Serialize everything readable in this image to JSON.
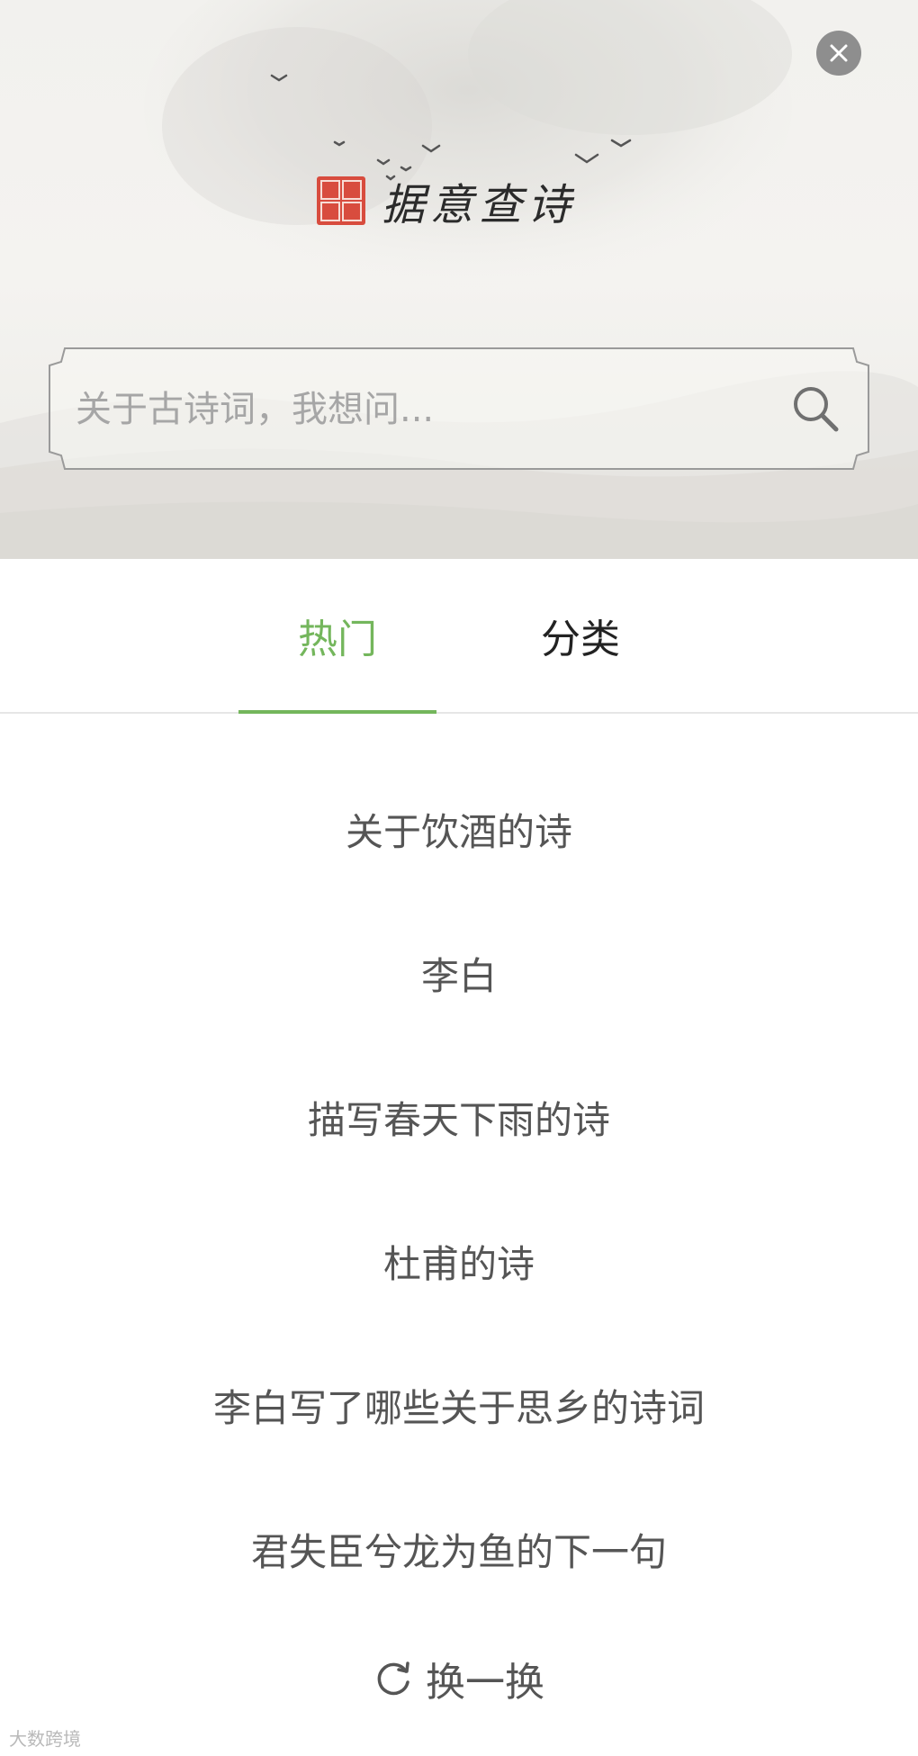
{
  "app": {
    "title": "据意查诗"
  },
  "header": {
    "close_icon": "close-icon",
    "logo_seal_icon": "seal-stamp-icon"
  },
  "search": {
    "placeholder": "关于古诗词，我想问...",
    "value": "",
    "icon": "search-icon"
  },
  "tabs": [
    {
      "label": "热门",
      "active": true
    },
    {
      "label": "分类",
      "active": false
    }
  ],
  "hot_list": [
    "关于饮酒的诗",
    "李白",
    "描写春天下雨的诗",
    "杜甫的诗",
    "李白写了哪些关于思乡的诗词",
    "君失臣兮龙为鱼的下一句"
  ],
  "refresh": {
    "label": "换一换",
    "icon": "refresh-icon"
  },
  "watermark": {
    "text": "大数跨境"
  },
  "colors": {
    "accent": "#74b65c",
    "close_bg": "#8e8e8e",
    "seal": "#d84c3e"
  }
}
